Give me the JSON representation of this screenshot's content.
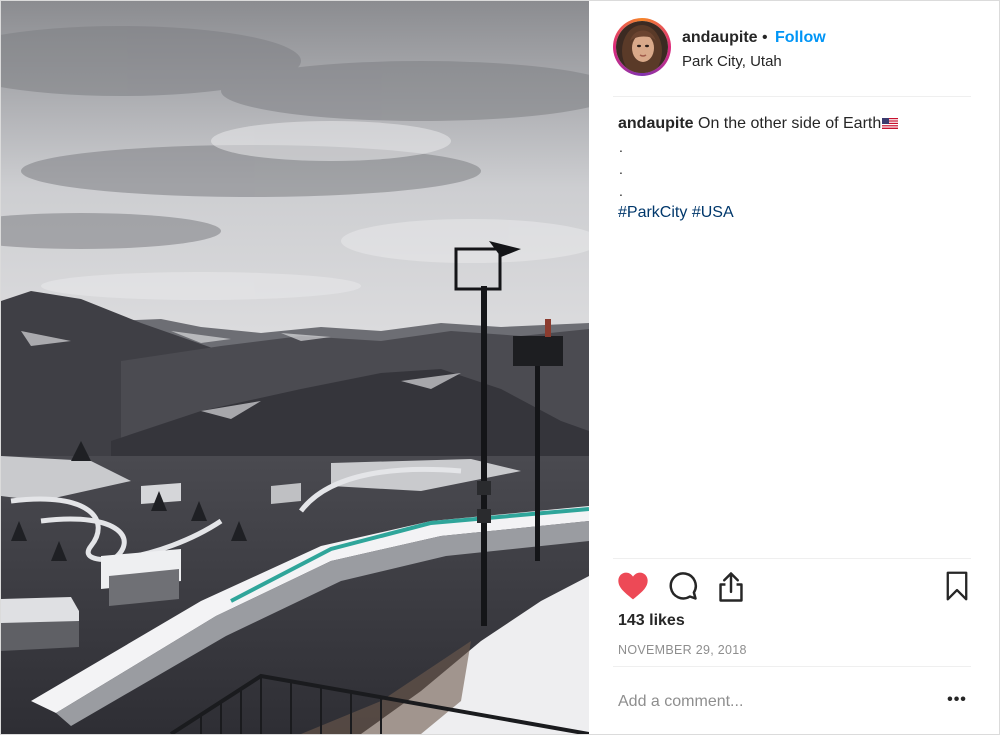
{
  "post": {
    "username": "andaupite",
    "separator": "•",
    "follow_label": "Follow",
    "location": "Park City, Utah",
    "caption": {
      "username": "andaupite",
      "text": "On the other side of Earth",
      "dot_lines": [
        ".",
        ".",
        "."
      ],
      "hashtags": [
        "#ParkCity",
        "#USA"
      ]
    },
    "likes": "143 likes",
    "date": "NOVEMBER 29, 2018",
    "comment_placeholder": "Add a comment...",
    "more_label": "•••"
  },
  "colors": {
    "like_heart": "#ed4956",
    "follow_blue": "#0095f6",
    "hashtag": "#00376b"
  },
  "icons": [
    "heart-icon",
    "comment-icon",
    "share-icon",
    "bookmark-icon",
    "us-flag-icon",
    "more-icon"
  ]
}
